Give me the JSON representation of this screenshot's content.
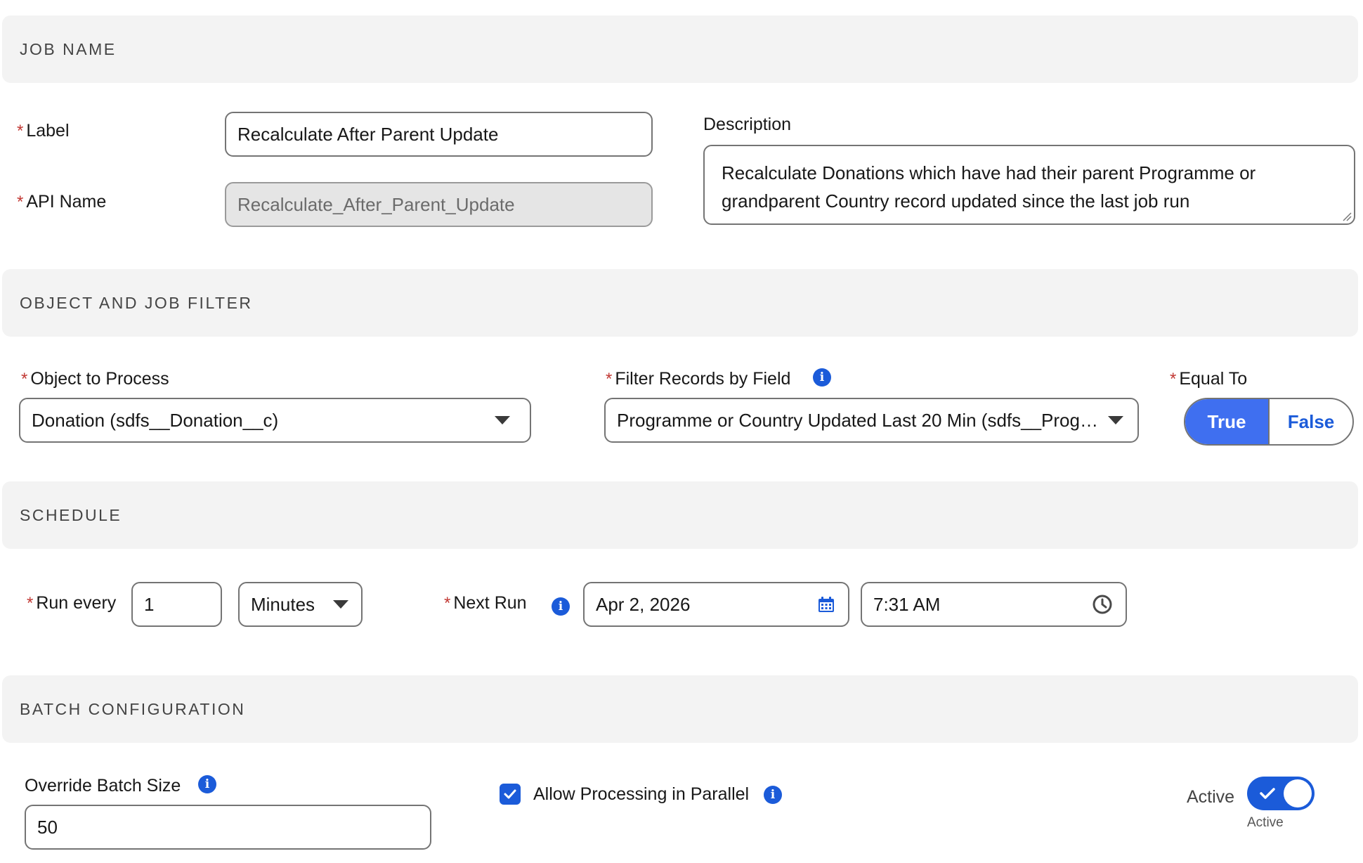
{
  "sections": {
    "job_name": "JOB NAME",
    "object_filter": "OBJECT AND JOB FILTER",
    "schedule": "SCHEDULE",
    "batch": "BATCH CONFIGURATION"
  },
  "required_marker": "*",
  "job": {
    "label_label": "Label",
    "label_value": "Recalculate After Parent Update",
    "api_label": "API Name",
    "api_value": "Recalculate_After_Parent_Update",
    "description_label": "Description",
    "description_value": "Recalculate Donations which have had their parent Programme or grandparent Country record updated since the last job run"
  },
  "filter": {
    "object_label": "Object to Process",
    "object_value": "Donation (sdfs__Donation__c)",
    "field_label": "Filter Records by Field",
    "field_value": "Programme or Country Updated Last 20 Min (sdfs__Progr...",
    "equal_label": "Equal To",
    "true_label": "True",
    "false_label": "False",
    "selected": "True"
  },
  "schedule": {
    "run_every_label": "Run every",
    "run_every_value": "1",
    "unit_value": "Minutes",
    "next_run_label": "Next Run",
    "date_value": "Apr 2, 2026",
    "time_value": "7:31 AM"
  },
  "batch": {
    "override_label": "Override Batch Size",
    "override_value": "50",
    "parallel_label": "Allow Processing in Parallel",
    "parallel_checked": true,
    "active_label": "Active",
    "active_sublabel": "Active",
    "active_on": true
  },
  "icons": {
    "info": "info-icon",
    "calendar": "calendar-icon",
    "clock": "clock-icon",
    "caret": "chevron-down-icon",
    "check": "checkmark-icon"
  },
  "colors": {
    "brand": "#1b5bd9",
    "toggle_selected": "#3f6ff0",
    "required": "#c23934",
    "section_bg": "#f3f3f3"
  }
}
